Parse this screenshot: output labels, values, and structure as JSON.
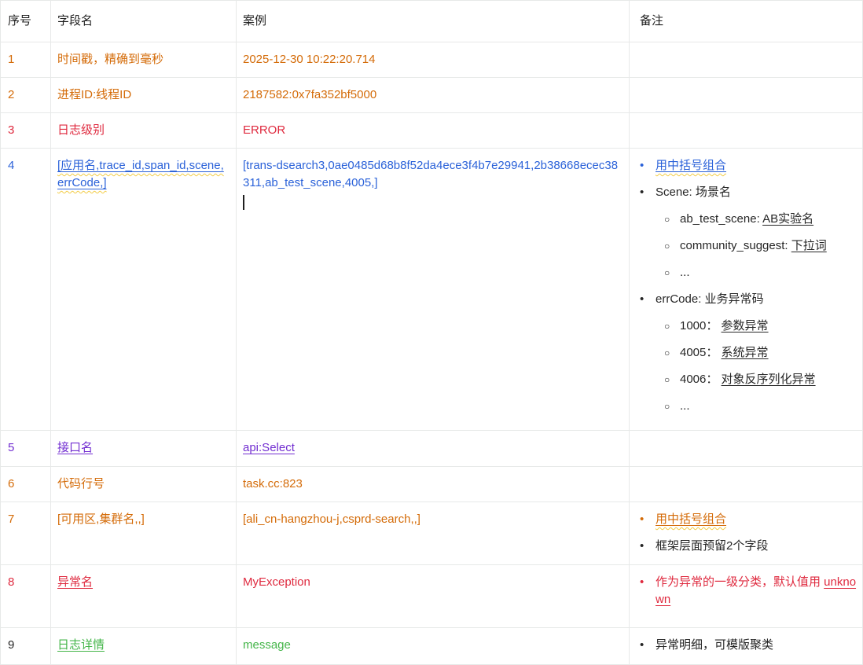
{
  "colors": {
    "orange": "#d46b08",
    "red": "#df2a3f",
    "blue": "#2b62d9",
    "purple": "#722ed1",
    "green": "#44b549",
    "text": "#262626",
    "border": "#e7e9e8",
    "squiggle": "#f3cc45"
  },
  "bullets": {
    "l1": "•",
    "l2": "○"
  },
  "header": {
    "col_no": "序号",
    "col_field": "字段名",
    "col_example": "案例",
    "col_note": "备注"
  },
  "rows": [
    {
      "no": "1",
      "field": "时间戳，精确到毫秒",
      "example": "2025-12-30 10:22:20.714"
    },
    {
      "no": "2",
      "field": "进程ID:线程ID",
      "example": "2187582:0x7fa352bf5000"
    },
    {
      "no": "3",
      "field": "日志级别",
      "example": "ERROR"
    },
    {
      "no": "4",
      "field": "[应用名,trace_id,span_id,scene,errCode,]",
      "example": "[trans-dsearch3,0ae0485d68b8f52da4ece3f4b7e29941,2b38668ecec38311,ab_test_scene,4005,]",
      "notes": [
        {
          "text": "用中括号组合"
        },
        {
          "text": "Scene: 场景名"
        },
        {
          "pre": "ab_test_scene: ",
          "u": "AB实验名"
        },
        {
          "pre": "community_suggest: ",
          "u": "下拉词"
        },
        {
          "text": "..."
        },
        {
          "text": "errCode: 业务异常码"
        },
        {
          "pre": "1000： ",
          "u": "参数异常"
        },
        {
          "pre": "4005： ",
          "u": "系统异常"
        },
        {
          "pre": "4006： ",
          "u": "对象反序列化异常"
        },
        {
          "text": "..."
        }
      ]
    },
    {
      "no": "5",
      "field": "接口名",
      "example": "api:Select"
    },
    {
      "no": "6",
      "field": "代码行号",
      "example": "task.cc:823"
    },
    {
      "no": "7",
      "field": "[可用区,集群名,,]",
      "example": "[ali_cn-hangzhou-j,csprd-search,,]",
      "notes": [
        {
          "text": "用中括号组合"
        },
        {
          "text": "框架层面预留2个字段"
        }
      ]
    },
    {
      "no": "8",
      "field": "异常名",
      "example": "MyException",
      "notes": [
        {
          "pre": "作为异常的一级分类，默认值用 ",
          "u": "unknown"
        }
      ]
    },
    {
      "no": "9",
      "field": "日志详情",
      "example": "message",
      "notes": [
        {
          "text": "异常明细，可模版聚类"
        }
      ]
    }
  ]
}
